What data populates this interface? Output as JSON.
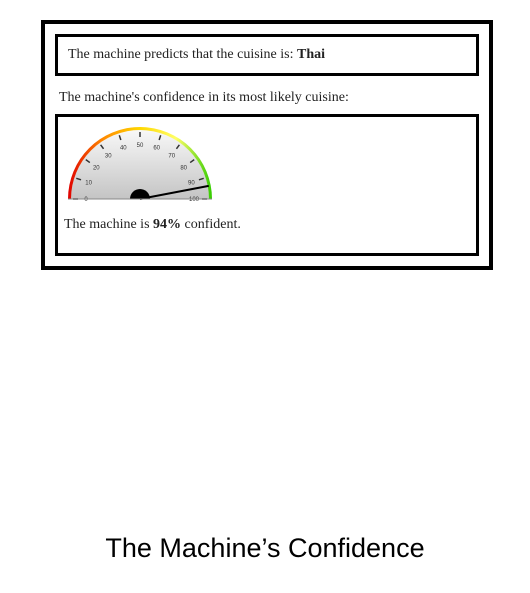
{
  "prediction": {
    "prefix": "The machine predicts that the cuisine is: ",
    "cuisine": "Thai"
  },
  "confidence_label": "The machine's confidence in its most likely cuisine:",
  "gauge": {
    "min": 0,
    "max": 100,
    "value": 94,
    "ticks": [
      "0",
      "10",
      "20",
      "30",
      "40",
      "50",
      "60",
      "70",
      "80",
      "90",
      "100"
    ],
    "colors": [
      "#e00000",
      "#ff8c00",
      "#ffd700",
      "#ffff66",
      "#33cc00"
    ]
  },
  "result": {
    "prefix": "The machine is ",
    "value": "94%",
    "suffix": " confident."
  },
  "caption": "The Machine’s Confidence"
}
